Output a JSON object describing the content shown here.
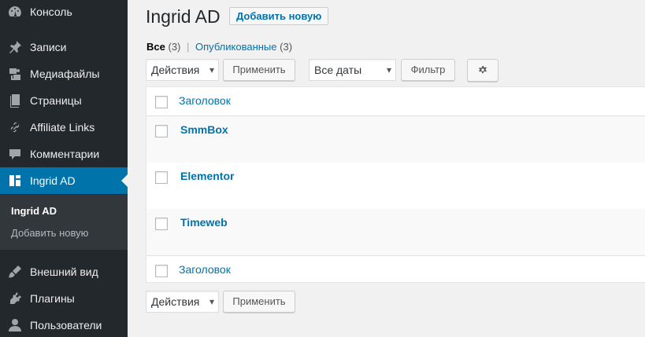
{
  "sidebar": {
    "items": [
      {
        "label": "Консоль",
        "icon": "dashboard-icon"
      },
      {
        "label": "Записи",
        "icon": "pin-icon"
      },
      {
        "label": "Медиафайлы",
        "icon": "media-icon"
      },
      {
        "label": "Страницы",
        "icon": "pages-icon"
      },
      {
        "label": "Affiliate Links",
        "icon": "link-icon"
      },
      {
        "label": "Комментарии",
        "icon": "comment-icon"
      },
      {
        "label": "Ingrid AD",
        "icon": "layout-icon"
      },
      {
        "label": "Внешний вид",
        "icon": "brush-icon"
      },
      {
        "label": "Плагины",
        "icon": "plugin-icon"
      },
      {
        "label": "Пользователи",
        "icon": "users-icon"
      }
    ],
    "submenu": [
      "Ingrid AD",
      "Добавить новую"
    ],
    "active_color": "#0073aa"
  },
  "header": {
    "title": "Ingrid AD",
    "add_new": "Добавить новую"
  },
  "filters": {
    "all_label": "Все",
    "all_count": "(3)",
    "separator": "|",
    "published_label": "Опубликованные",
    "published_count": "(3)"
  },
  "toolbar": {
    "bulk_actions": "Действия",
    "apply": "Применить",
    "dates": "Все даты",
    "filter": "Фильтр"
  },
  "table": {
    "column_title": "Заголовок",
    "rows": [
      "SmmBox",
      "Elementor",
      "Timeweb"
    ]
  },
  "bottom_toolbar": {
    "bulk_actions": "Действия",
    "apply": "Применить"
  }
}
